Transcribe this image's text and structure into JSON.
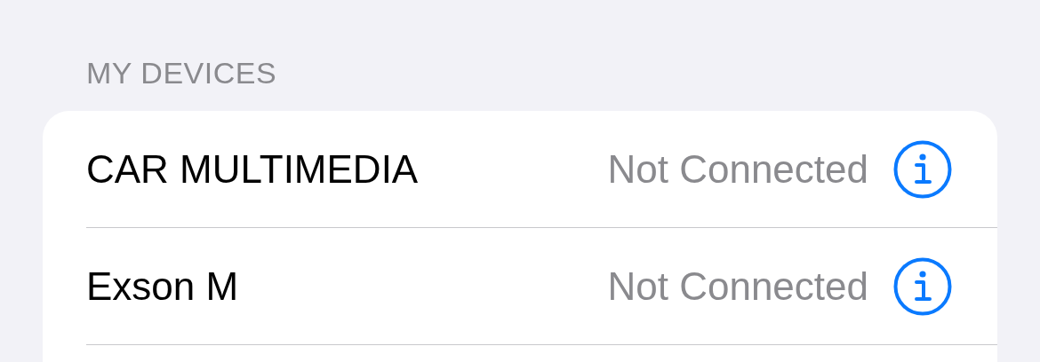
{
  "section": {
    "header": "MY DEVICES"
  },
  "devices": [
    {
      "name": "CAR MULTIMEDIA",
      "status": "Not Connected"
    },
    {
      "name": "Exson M",
      "status": "Not Connected"
    }
  ]
}
